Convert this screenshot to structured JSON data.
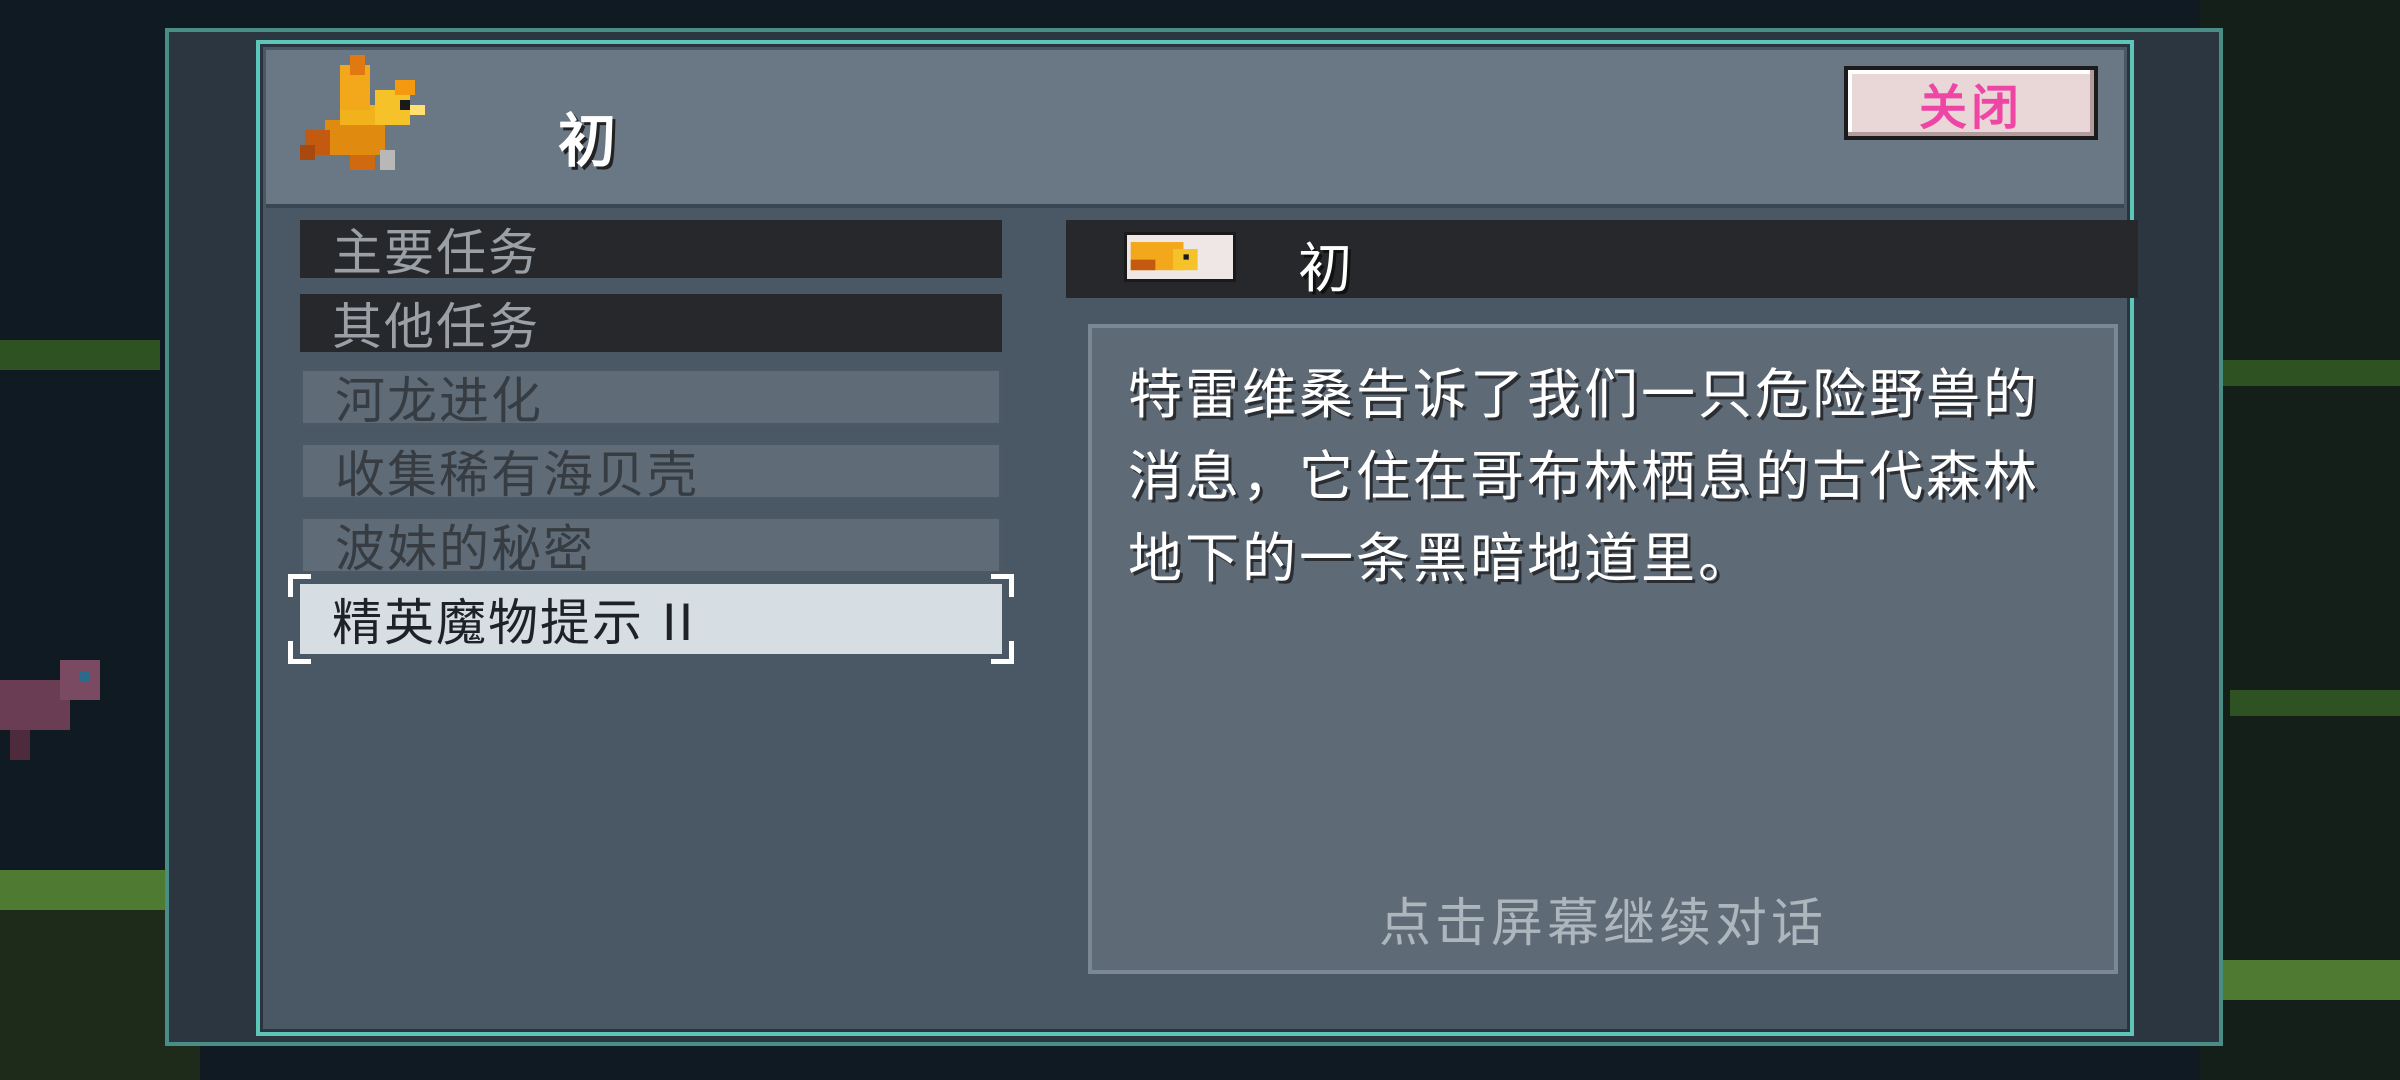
{
  "dialog": {
    "title": "初",
    "close_label": "关闭"
  },
  "quest_list": {
    "main_header": "主要任务",
    "other_header": "其他任务",
    "items": [
      {
        "label": "河龙进化"
      },
      {
        "label": "收集稀有海贝壳"
      },
      {
        "label": "波妹的秘密"
      },
      {
        "label": "精英魔物提示 II"
      }
    ],
    "selected_index": 3
  },
  "detail": {
    "title": "初",
    "body": "特雷维桑告诉了我们一只危险野兽的消息，它住在哥布林栖息的古代森林地下的一条黑暗地道里。",
    "continue_hint": "点击屏幕继续对话"
  },
  "colors": {
    "accent_border": "#5cc7b8",
    "close_text": "#ef46a6",
    "panel": "#4a5866"
  },
  "icons": {
    "speaker": "phoenix-bird-icon"
  }
}
